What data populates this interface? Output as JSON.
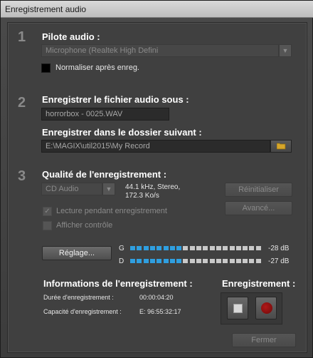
{
  "window": {
    "title": "Enregistrement audio"
  },
  "section1": {
    "number": "1",
    "heading": "Pilote audio :",
    "driver_value": "Microphone (Realtek High Defini",
    "normalize_label": "Normaliser après enreg."
  },
  "section2": {
    "number": "2",
    "file_heading": "Enregistrer le fichier audio sous :",
    "file_name": "horrorbox - 0025.WAV",
    "folder_heading": "Enregistrer dans le dossier suivant :",
    "folder_path": "E:\\MAGIX\\util2015\\My Record"
  },
  "section3": {
    "number": "3",
    "heading": "Qualité de l'enregistrement :",
    "quality_value": "CD Audio",
    "quality_info_line1": "44.1 kHz, Stereo,",
    "quality_info_line2": "172.3 Ko/s",
    "reset_label": "Réinitialiser",
    "advanced_label": "Avancé...",
    "playback_label": "Lecture pendant enregistrement",
    "playback_checked": true,
    "show_control_label": "Afficher contrôle",
    "settings_label": "Réglage..."
  },
  "meters": {
    "left_label": "G",
    "right_label": "D",
    "left_db": "-28 dB",
    "right_db": "-27 dB",
    "segments_total": 20,
    "left_lit": 8,
    "right_lit": 8,
    "lit_color": "#2f9fe0",
    "unlit_color": "#c9c9c9"
  },
  "info": {
    "heading": "Informations de l'enregistrement :",
    "duration_label": "Durée d'enregistrement :",
    "duration_value": "00:00:04:20",
    "capacity_label": "Capacité d'enregistrement :",
    "capacity_value": "E: 96:55:32:17"
  },
  "recording": {
    "heading": "Enregistrement :",
    "stop_icon": "stop-icon",
    "record_icon": "record-icon"
  },
  "footer": {
    "close_label": "Fermer"
  }
}
